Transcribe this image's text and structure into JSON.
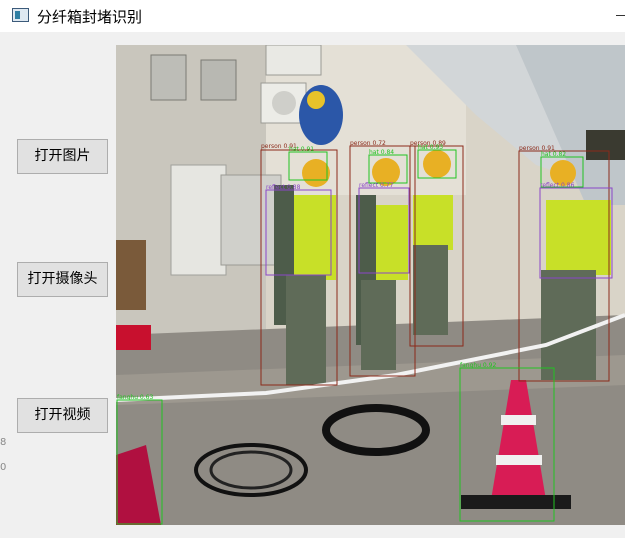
{
  "window": {
    "title": "分纤箱封堵识别",
    "icon": "app-window-icon"
  },
  "buttons": {
    "open_image": "打开图片",
    "open_camera": "打开摄像头",
    "open_video": "打开视频"
  },
  "edge_glyphs": [
    "8",
    "0"
  ],
  "detections": [
    {
      "label": "person 0.91",
      "class": "person",
      "color": "#8b2a1a"
    },
    {
      "label": "hat 0.91",
      "class": "hat",
      "color": "#22c322"
    },
    {
      "label": "reflect 0.88",
      "class": "reflect",
      "color": "#8a46c8"
    },
    {
      "label": "person 0.72",
      "class": "person",
      "color": "#8b2a1a"
    },
    {
      "label": "hat 0.84",
      "class": "hat",
      "color": "#22c322"
    },
    {
      "label": "reflect 0.77",
      "class": "reflect",
      "color": "#8a46c8"
    },
    {
      "label": "person 0.89",
      "class": "person",
      "color": "#8b2a1a"
    },
    {
      "label": "hat 0.93",
      "class": "hat",
      "color": "#22c322"
    },
    {
      "label": "person 0.91",
      "class": "person",
      "color": "#8b2a1a"
    },
    {
      "label": "hat 0.82",
      "class": "hat",
      "color": "#22c322"
    },
    {
      "label": "reflect 0.86",
      "class": "reflect",
      "color": "#8a46c8"
    },
    {
      "label": "fanghu 0.92",
      "class": "fanghu",
      "color": "#22c322"
    },
    {
      "label": "fanghu 0.63",
      "class": "fanghu",
      "color": "#22c322"
    }
  ]
}
